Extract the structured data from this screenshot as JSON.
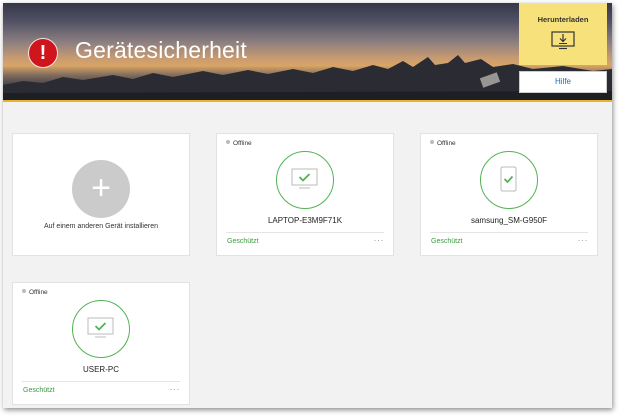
{
  "header": {
    "title": "Gerätesicherheit",
    "warning_icon": "exclamation-icon",
    "download_label": "Herunterladen",
    "download_icon": "monitor-download-icon",
    "help_label": "Hilfe"
  },
  "add_card": {
    "icon": "plus-icon",
    "label": "Auf einem anderen Gerät installieren"
  },
  "devices": [
    {
      "status": "Offline",
      "name": "LAPTOP-E3M9F71K",
      "type": "pc",
      "protection": "Geschützt",
      "more": "···"
    },
    {
      "status": "Offline",
      "name": "samsung_SM-G950F",
      "type": "phone",
      "protection": "Geschützt",
      "more": "···"
    },
    {
      "status": "Offline",
      "name": "USER-PC",
      "type": "pc",
      "protection": "Geschützt",
      "more": "···"
    }
  ],
  "colors": {
    "accent_green": "#52b356",
    "warning_red": "#d0161c",
    "download_yellow": "#f6e17a",
    "link_blue": "#1a6fb5"
  }
}
